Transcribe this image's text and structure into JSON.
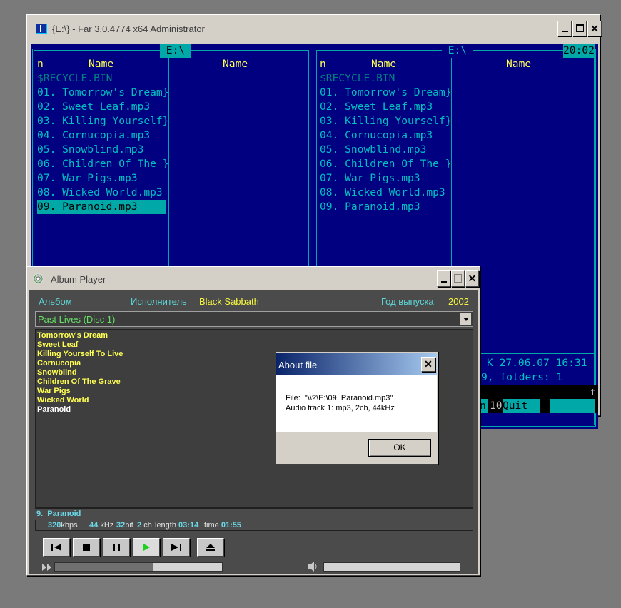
{
  "far": {
    "title": "{E:\\} - Far 3.0.4774 x64 Administrator",
    "left_path": " E:\\ ",
    "right_path": " E:\\ ",
    "clock": "20:02",
    "col_n": "n",
    "col_name": "Name",
    "recycle": "$RECYCLE.BIN",
    "files": [
      "01. Tomorrow's Dream}",
      "02. Sweet Leaf.mp3",
      "03. Killing Yourself}",
      "04. Cornucopia.mp3",
      "05. Snowblind.mp3",
      "06. Children Of The }",
      "07. War Pigs.mp3",
      "08. Wicked World.mp3",
      "09. Paranoid.mp3"
    ],
    "info_line1": "K 27.06.07 16:31",
    "info_line2": "9, folders: 1",
    "scroll_arrow": "↑",
    "fkey_n": "n",
    "fkey_10": "10",
    "fkey_quit": "Quit"
  },
  "player": {
    "title": "Album Player",
    "album_label": "Альбом",
    "artist_label": "Исполнитель",
    "artist": "Black Sabbath",
    "year_label": "Год выпуска",
    "year": "2002",
    "disc": "Past Lives (Disc 1)",
    "tracks": [
      "Tomorrow's Dream",
      "Sweet Leaf",
      "Killing Yourself To Live",
      "Cornucopia",
      "Snowblind",
      "Children Of The Grave",
      "War Pigs",
      "Wicked World",
      "Paranoid"
    ],
    "current_track": "9.  Paranoid",
    "bitrate": "320",
    "bitrate_unit": "kbps",
    "freq": "44",
    "freq_unit": "kHz",
    "bits": "32",
    "bits_unit": "bit",
    "channels": "2",
    "channels_unit": "ch",
    "length_label": "length",
    "length": "03:14",
    "time_label": "time",
    "time": "01:55",
    "seek_progress": 0.59,
    "volume_level": 0.0
  },
  "dialog": {
    "title": "About file",
    "file_line": "File:  \"\\\\?\\E:\\09. Paranoid.mp3\"",
    "audio_line": "Audio track 1: mp3, 2ch, 44kHz",
    "ok": "OK"
  }
}
